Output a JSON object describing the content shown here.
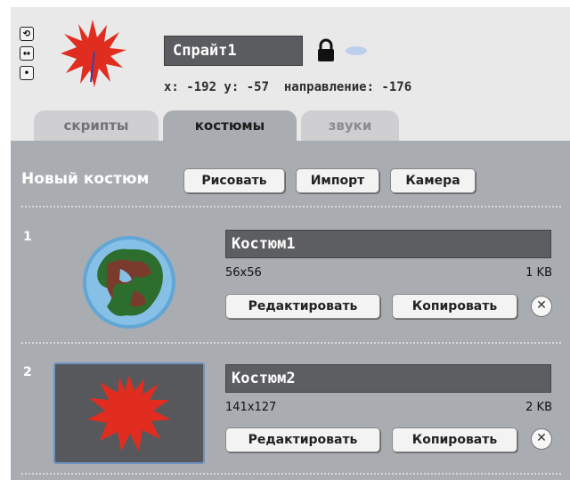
{
  "sprite": {
    "name": "Спрайт1",
    "info": "x: -192 y: -57  направление: -176",
    "controls": [
      "rotate-icon",
      "flip-icon",
      "no-rotate-icon"
    ]
  },
  "tabs": [
    {
      "label": "скрипты",
      "active": false
    },
    {
      "label": "костюмы",
      "active": true
    },
    {
      "label": "звуки",
      "active": false
    }
  ],
  "costumes_panel": {
    "new_costume_label": "Новый костюм",
    "paint_button": "Рисовать",
    "import_button": "Импорт",
    "camera_button": "Камера"
  },
  "costumes": [
    {
      "number": "1",
      "name": "Костюм1",
      "dimensions": "56x56",
      "size": "1 KB",
      "edit_button": "Редактировать",
      "copy_button": "Копировать"
    },
    {
      "number": "2",
      "name": "Костюм2",
      "dimensions": "141x127",
      "size": "2 KB",
      "edit_button": "Редактировать",
      "copy_button": "Копировать"
    }
  ],
  "colors": {
    "accent": "#6e92c0",
    "panel": "#a9acb1",
    "header": "#e9e9ea",
    "sprite": "#e02d1f"
  }
}
